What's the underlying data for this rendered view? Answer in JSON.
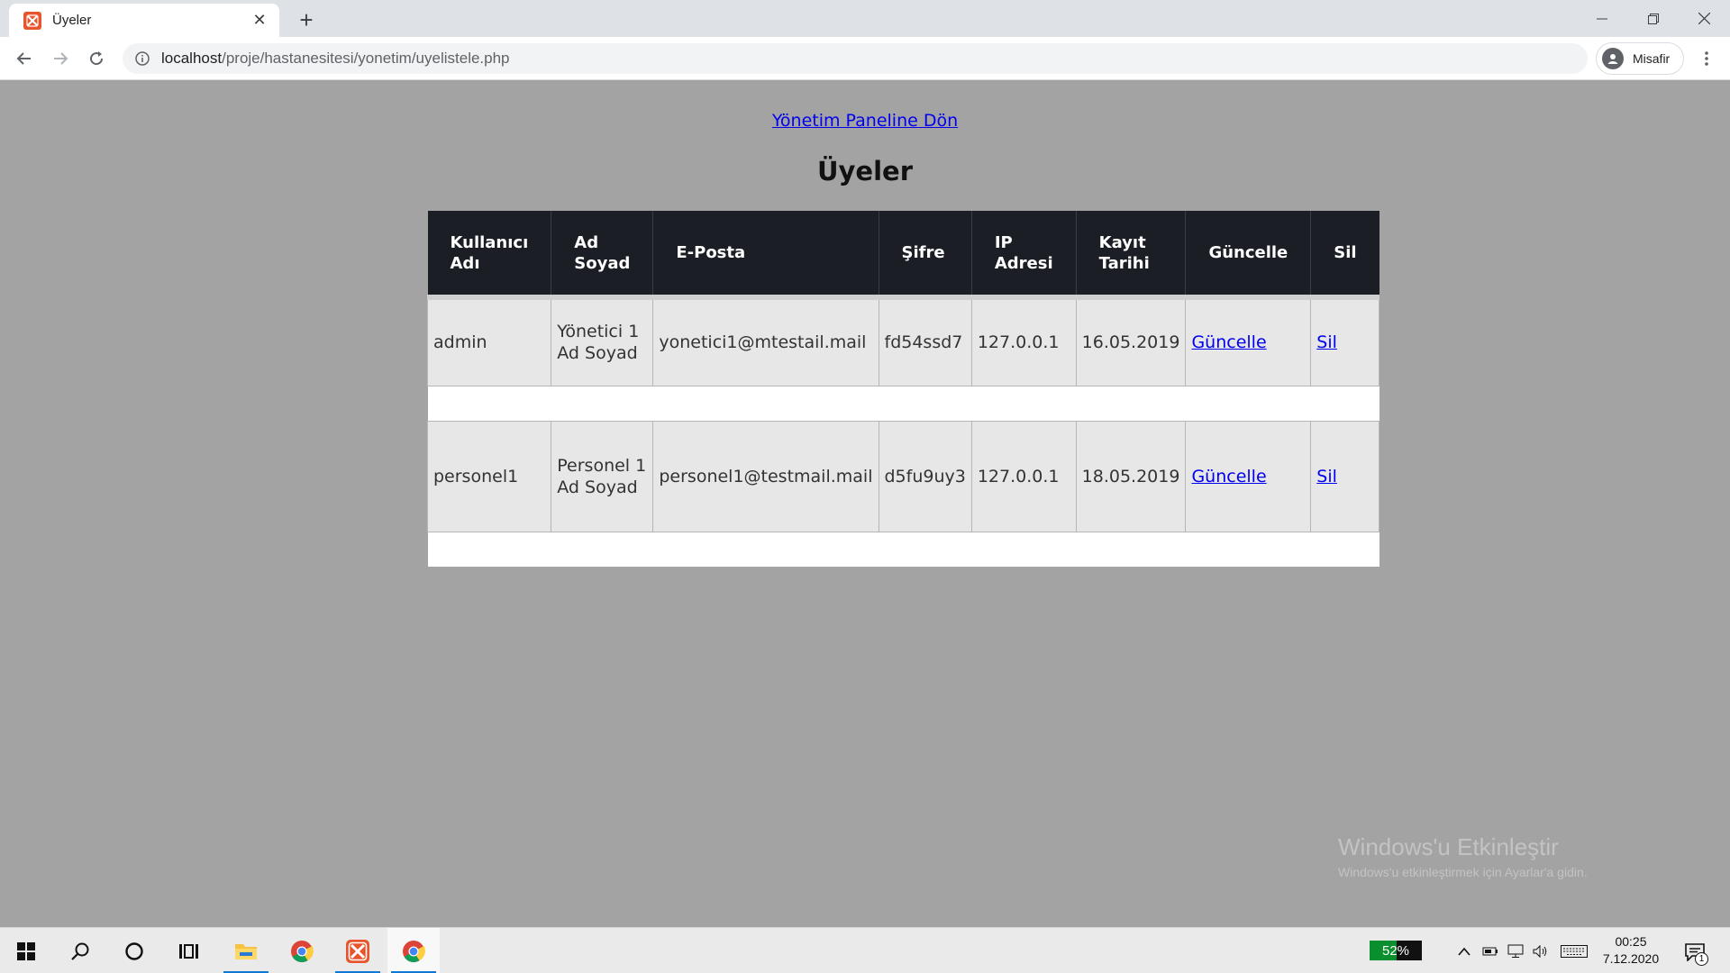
{
  "browser": {
    "tab_title": "Üyeler",
    "url_host": "localhost",
    "url_path": "/proje/hastanesitesi/yonetim/uyelistele.php",
    "profile_label": "Misafir"
  },
  "page": {
    "back_link": "Yönetim Paneline Dön",
    "title": "Üyeler"
  },
  "table": {
    "headers": {
      "username": "Kullanıcı Adı",
      "fullname": "Ad Soyad",
      "email": "E-Posta",
      "password": "Şifre",
      "ip": "IP Adresi",
      "date": "Kayıt Tarihi",
      "update": "Güncelle",
      "delete": "Sil"
    },
    "rows": [
      {
        "username": "admin",
        "fullname": "Yönetici 1 Ad Soyad",
        "email": "yonetici1@mtestail.mail",
        "password": "fd54ssd7",
        "ip": "127.0.0.1",
        "date": "16.05.2019",
        "update": "Güncelle",
        "delete": "Sil"
      },
      {
        "username": "personel1",
        "fullname": "Personel 1 Ad Soyad",
        "email": "personel1@testmail.mail",
        "password": "d5fu9uy3",
        "ip": "127.0.0.1",
        "date": "18.05.2019",
        "update": "Güncelle",
        "delete": "Sil"
      }
    ]
  },
  "watermark": {
    "line1": "Windows'u Etkinleştir",
    "line2": "Windows'u etkinleştirmek için Ayarlar'a gidin."
  },
  "taskbar": {
    "battery_percent": "52%",
    "battery_level": 0.52,
    "time": "00:25",
    "date": "7.12.2020",
    "notification_count": "1"
  },
  "icons": [
    "xampp-icon",
    "close-icon",
    "plus-icon",
    "back-arrow-icon",
    "forward-arrow-icon",
    "reload-icon",
    "info-icon",
    "profile-icon",
    "kebab-menu-icon",
    "windows-start-icon",
    "search-icon",
    "cortana-icon",
    "task-view-icon",
    "file-explorer-icon",
    "chrome-icon",
    "notification-icon"
  ],
  "colors": {
    "page_bg": "#a3a3a3",
    "table_header_bg": "#1b1e25",
    "link": "#0000ee",
    "xampp": "#e8542c"
  }
}
